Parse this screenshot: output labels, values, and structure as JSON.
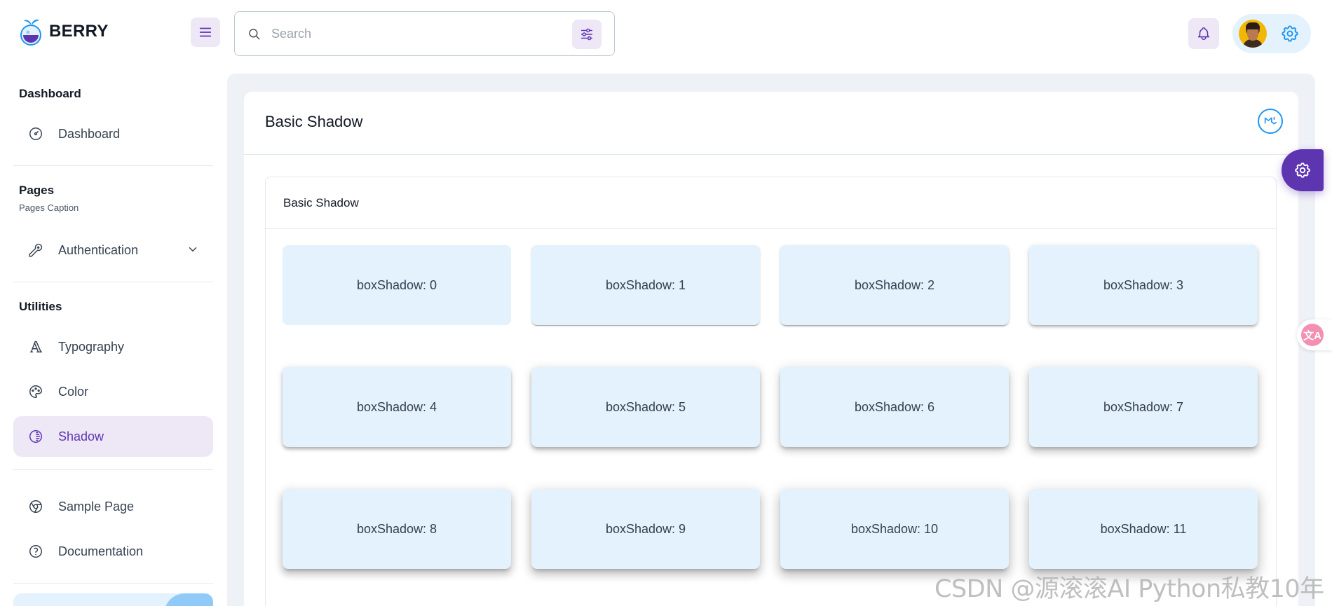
{
  "header": {
    "brand": "BERRY",
    "search_placeholder": "Search"
  },
  "sidebar": {
    "groups": [
      {
        "heading": "Dashboard",
        "items": [
          {
            "label": "Dashboard",
            "icon": "dashboard-icon"
          }
        ]
      },
      {
        "heading": "Pages",
        "caption": "Pages Caption",
        "items": [
          {
            "label": "Authentication",
            "icon": "key-icon"
          }
        ]
      },
      {
        "heading": "Utilities",
        "items": [
          {
            "label": "Typography",
            "icon": "typography-icon"
          },
          {
            "label": "Color",
            "icon": "palette-icon"
          },
          {
            "label": "Shadow",
            "icon": "shadow-icon",
            "active": true
          }
        ]
      },
      {
        "heading": "",
        "items": [
          {
            "label": "Sample Page",
            "icon": "brand-chrome-icon"
          },
          {
            "label": "Documentation",
            "icon": "help-icon"
          }
        ]
      }
    ]
  },
  "main": {
    "page_title": "Basic Shadow",
    "section_title": "Basic Shadow",
    "shadow_boxes": [
      "boxShadow: 0",
      "boxShadow: 1",
      "boxShadow: 2",
      "boxShadow: 3",
      "boxShadow: 4",
      "boxShadow: 5",
      "boxShadow: 6",
      "boxShadow: 7",
      "boxShadow: 8",
      "boxShadow: 9",
      "boxShadow: 10",
      "boxShadow: 11"
    ]
  },
  "floating": {
    "translate_glyph": "文A"
  },
  "watermark": "CSDN @源滚滚AI Python私教10年",
  "colors": {
    "primary": "#5e35b1",
    "primary_light": "#ede7f6",
    "secondary": "#2196f3",
    "secondary_light": "#e3f2fd",
    "background": "#eef2f6"
  }
}
